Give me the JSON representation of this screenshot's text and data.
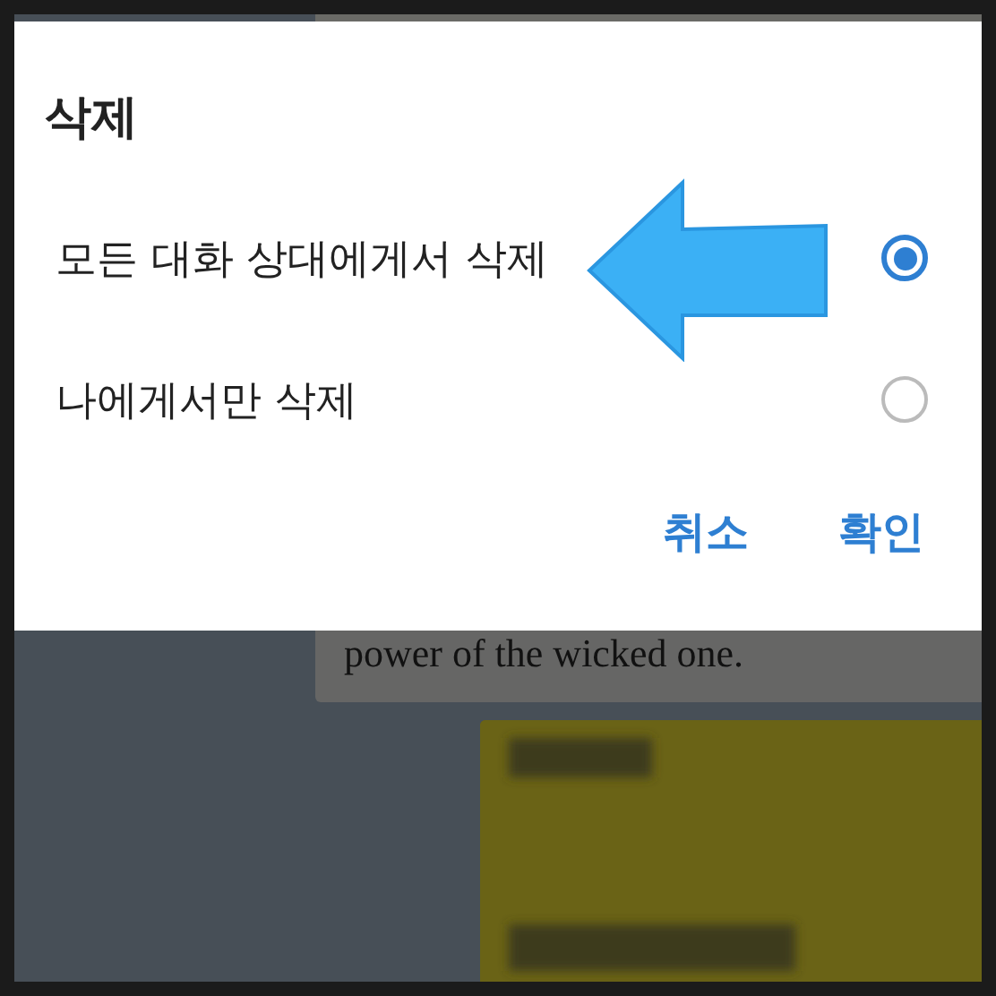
{
  "dialog": {
    "title": "삭제",
    "options": [
      {
        "label": "모든 대화 상대에게서 삭제",
        "selected": true
      },
      {
        "label": "나에게서만 삭제",
        "selected": false
      }
    ],
    "buttons": [
      "취소",
      "확인"
    ]
  },
  "chat": {
    "messages": [
      {
        "kind": "text",
        "text": "power of the wicked one."
      },
      {
        "kind": "blurred"
      }
    ]
  }
}
